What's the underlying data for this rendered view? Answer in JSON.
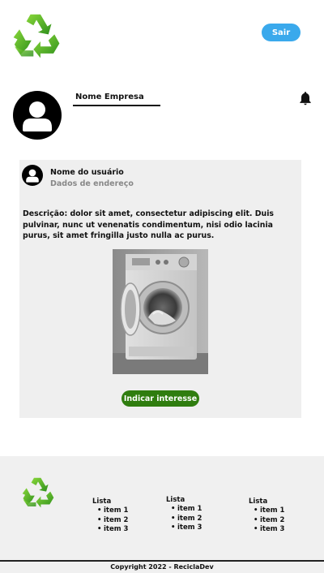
{
  "header": {
    "logo_icon": "recycle-icon",
    "logout_label": "Sair"
  },
  "company": {
    "avatar_icon": "user-avatar-icon",
    "name": "Nome Empresa",
    "notification_icon": "bell-icon"
  },
  "post": {
    "user_name": "Nome do usuário",
    "user_address": "Dados de endereço",
    "description": "Descrição: dolor sit amet, consectetur adipiscing elit. Duis pulvinar, nunc ut venenatis condimentum, nisi odio lacinia purus, sit amet fringilla justo nulla ac purus.",
    "image_subject": "washing-machine",
    "action_label": "Indicar interesse"
  },
  "footer": {
    "logo_icon": "recycle-icon",
    "lists": [
      {
        "title": "Lista",
        "items": [
          "item 1",
          "item 2",
          "item 3"
        ]
      },
      {
        "title": "Lista",
        "items": [
          "item 1",
          "item 2",
          "item 3"
        ]
      },
      {
        "title": "Lista",
        "items": [
          "item 1",
          "item 2",
          "item 3"
        ]
      }
    ],
    "copyright": "Copyright 2022 - ReciclaDev"
  },
  "colors": {
    "logout_button": "#3aa9ec",
    "action_button": "#2f7d0f",
    "card_background": "#efefef",
    "footer_background": "#f0f0f0",
    "recycle_green": "#4caf28"
  }
}
